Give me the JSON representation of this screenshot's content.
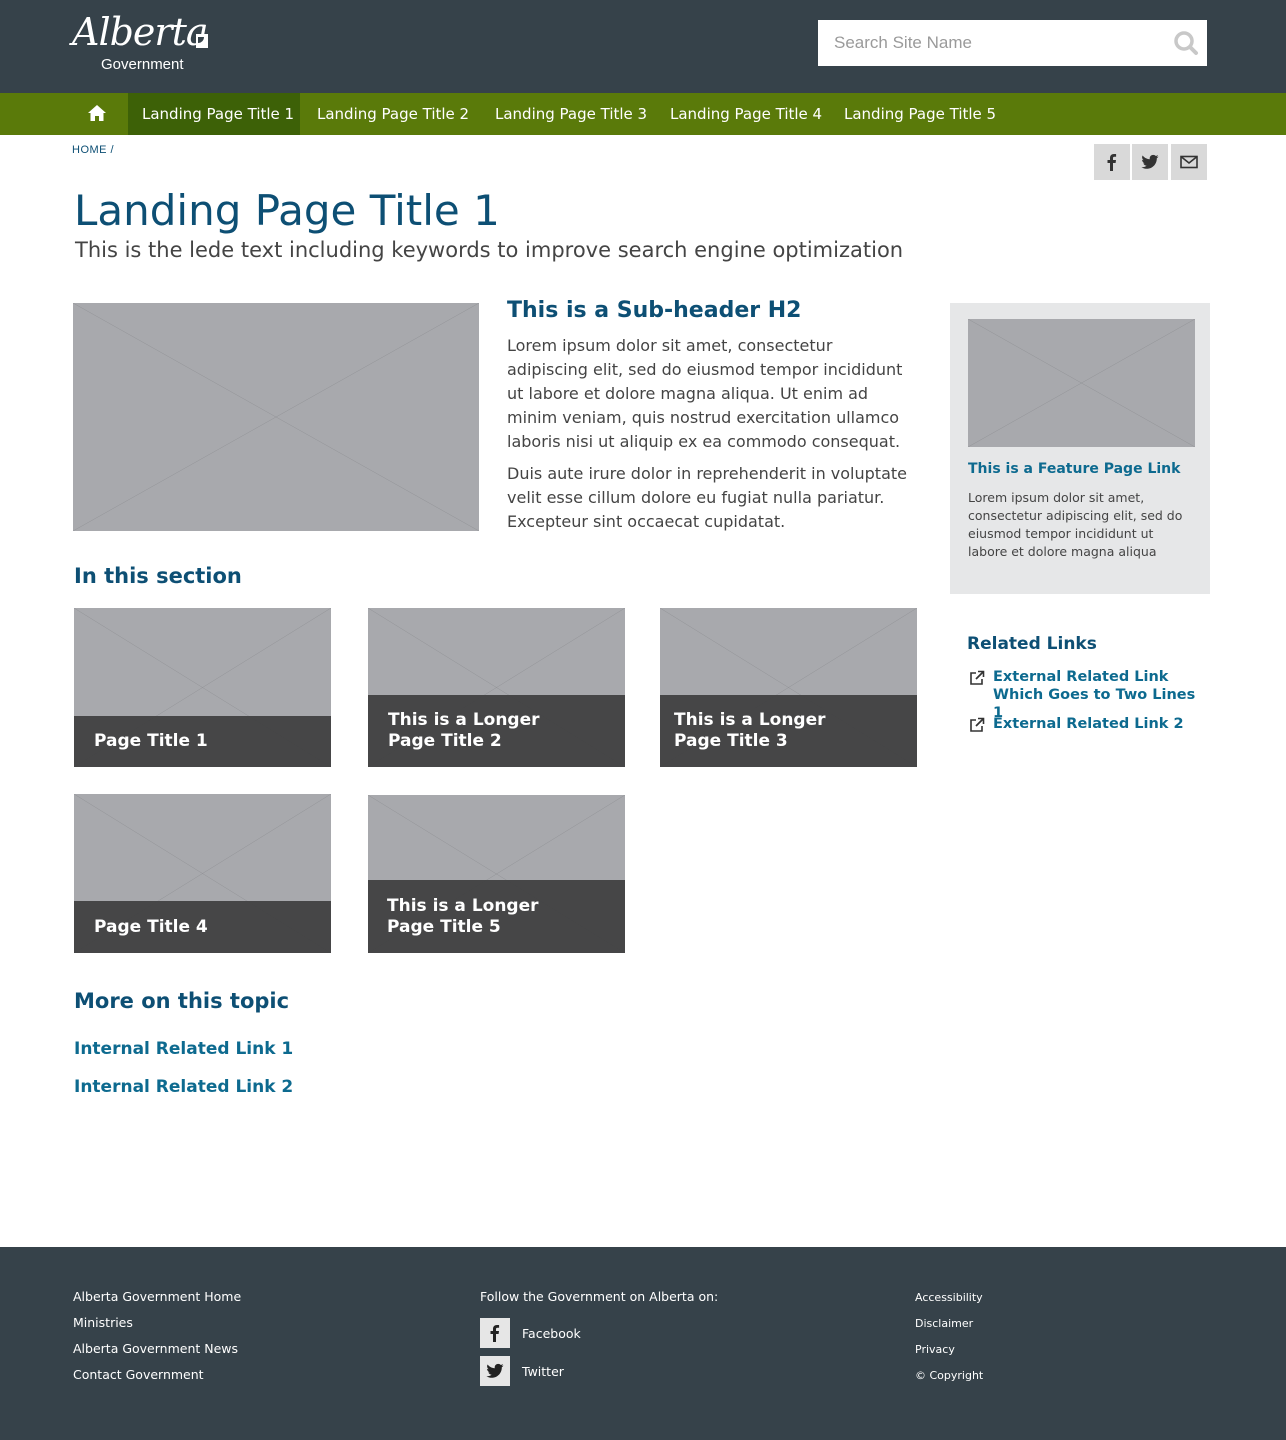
{
  "header": {
    "logo_script": "Alberta",
    "logo_sub": "Government",
    "search_placeholder": "Search Site Name"
  },
  "nav": {
    "items": [
      {
        "label": "Landing Page Title 1",
        "active": true
      },
      {
        "label": "Landing Page Title 2"
      },
      {
        "label": "Landing Page Title 3"
      },
      {
        "label": "Landing Page Title 4"
      },
      {
        "label": "Landing Page Title 5"
      }
    ]
  },
  "breadcrumb": "HOME  /",
  "page": {
    "title": "Landing Page Title 1",
    "lede": "This is the lede text including keywords to improve search engine optimization"
  },
  "intro": {
    "subheader": "This is a Sub-header H2",
    "paragraphs": [
      "Lorem ipsum dolor sit amet, consectetur adipiscing elit, sed do eiusmod tempor incididunt ut labore et dolore magna aliqua. Ut enim ad minim veniam, quis nostrud exercitation ullamco laboris nisi ut aliquip ex ea commodo consequat.",
      "Duis aute irure dolor in reprehenderit in voluptate velit esse cillum dolore eu fugiat nulla pariatur. Excepteur sint occaecat cupidatat."
    ]
  },
  "feature": {
    "link": "This is a Feature Page Link",
    "text": "Lorem ipsum dolor sit amet, consectetur adipiscing elit, sed do eiusmod tempor incididunt ut labore et dolore magna aliqua"
  },
  "section": {
    "heading": "In this section",
    "cards": [
      {
        "title": "Page Title 1"
      },
      {
        "title": "This is a Longer Page Title 2"
      },
      {
        "title": "This is a Longer Page Title 3"
      },
      {
        "title": "Page Title 4"
      },
      {
        "title": "This is a Longer Page Title 5"
      }
    ]
  },
  "related": {
    "heading": "Related Links",
    "links": [
      "External Related Link Which Goes to Two Lines 1",
      "External Related Link 2"
    ]
  },
  "more": {
    "heading": "More on this topic",
    "links": [
      "Internal Related Link 1",
      "Internal Related Link 2"
    ]
  },
  "footer": {
    "col1": [
      "Alberta Government Home",
      "Ministries",
      "Alberta Government News",
      "Contact Government"
    ],
    "follow_heading": "Follow the Government on Alberta on:",
    "social": [
      "Facebook",
      "Twitter"
    ],
    "col3": [
      "Accessibility",
      "Disclaimer",
      "Privacy",
      "© Copyright"
    ]
  },
  "colors": {
    "header_bg": "#36424a",
    "nav_bg": "#5a7a0a",
    "nav_active": "#3d6107",
    "heading_blue": "#0d4f74",
    "link_blue": "#0d6a8f",
    "placeholder_gray": "#a8a9ad",
    "caption_dark": "#3e3e40"
  },
  "icons": [
    "home-icon",
    "search-icon",
    "facebook-icon",
    "twitter-icon",
    "email-icon",
    "external-link-icon"
  ]
}
